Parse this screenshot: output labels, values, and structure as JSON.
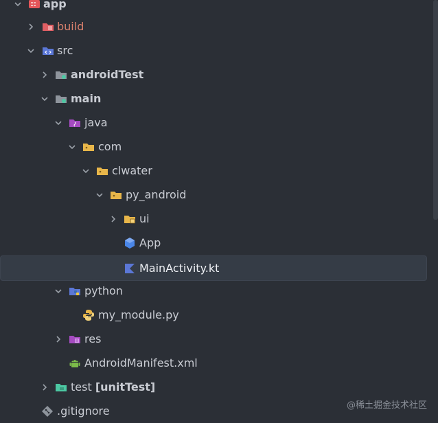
{
  "colors": {
    "background": "#2b2f36",
    "selected_row": "#353c46",
    "folder_yellow": "#e8b64a",
    "module_purple": "#a54bc1",
    "src_blue": "#5b77d6",
    "test_green": "#4cc8a3"
  },
  "tree": {
    "items": [
      {
        "label": "app",
        "icon": "module-folder-icon",
        "expanded": true
      },
      {
        "label": "build",
        "icon": "excluded-folder-icon",
        "expanded": false
      },
      {
        "label": "src",
        "icon": "source-folder-icon",
        "expanded": true
      },
      {
        "label": "androidTest",
        "icon": "folder-icon",
        "expanded": false
      },
      {
        "label": "main",
        "icon": "folder-icon",
        "expanded": true
      },
      {
        "label": "java",
        "icon": "java-source-folder-icon",
        "expanded": true
      },
      {
        "label": "com",
        "icon": "package-icon",
        "expanded": true
      },
      {
        "label": "clwater",
        "icon": "package-icon",
        "expanded": true
      },
      {
        "label": "py_android",
        "icon": "package-icon",
        "expanded": true
      },
      {
        "label": "ui",
        "icon": "package-icon",
        "expanded": false
      },
      {
        "label": "App",
        "icon": "kotlin-class-icon"
      },
      {
        "label": "MainActivity.kt",
        "icon": "kotlin-file-icon",
        "selected": true
      },
      {
        "label": "python",
        "icon": "python-folder-icon",
        "expanded": true
      },
      {
        "label": "my_module.py",
        "icon": "python-file-icon"
      },
      {
        "label": "res",
        "icon": "resources-folder-icon",
        "expanded": false
      },
      {
        "label": "AndroidManifest.xml",
        "icon": "android-icon"
      },
      {
        "label": "test",
        "suffix": "[unitTest]",
        "icon": "test-folder-icon",
        "expanded": false
      },
      {
        "label": ".gitignore",
        "icon": "git-icon"
      }
    ]
  },
  "watermark": "@稀土掘金技术社区"
}
